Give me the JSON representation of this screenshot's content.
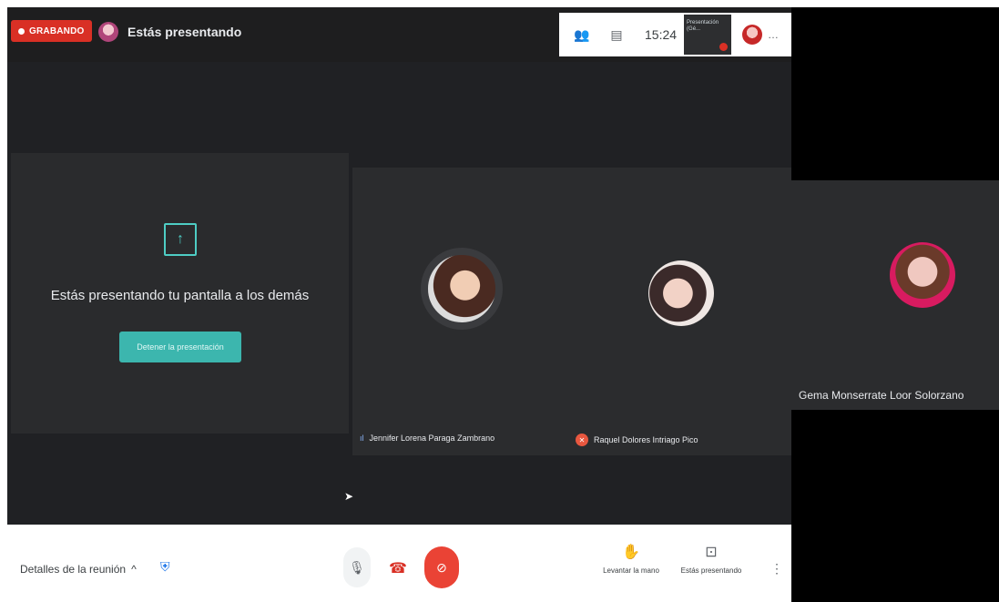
{
  "topbar": {
    "recording_label": "GRABANDO",
    "presenting_label": "Estás presentando",
    "time": "15:24",
    "thumb_text": "Presentación (Gé..."
  },
  "present_tile": {
    "message": "Estás presentando tu pantalla a los demás",
    "stop_button": "Detener la presentación"
  },
  "participants": [
    {
      "name": "Jennifer Lorena Paraga Zambrano"
    },
    {
      "name": "Raquel Dolores Intriago Pico"
    },
    {
      "name": "Gema Monserrate Loor Solorzano"
    }
  ],
  "bottombar": {
    "meeting_details": "Detalles de la reunión",
    "raise_hand": "Levantar la mano",
    "presenting": "Estás presentando"
  },
  "colors": {
    "recording": "#d93025",
    "accent": "#4ecdc4",
    "end_call": "#ea4335"
  }
}
